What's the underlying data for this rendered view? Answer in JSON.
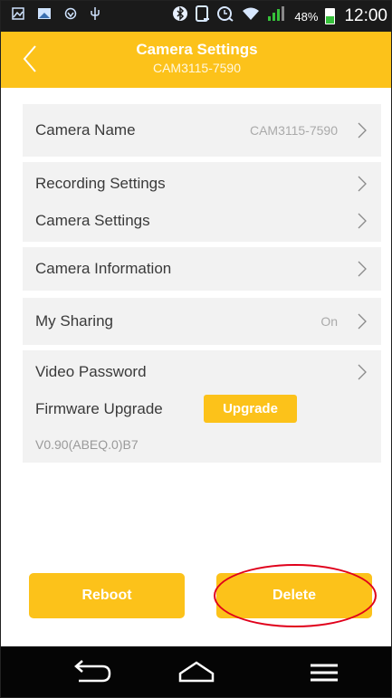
{
  "status_bar": {
    "icons_left": [
      "image-icon",
      "screen-icon",
      "shield-icon",
      "usb-icon"
    ],
    "icons_right": [
      "bluetooth-icon",
      "nfc-icon",
      "alarm-icon",
      "wifi-icon",
      "signal-icon"
    ],
    "battery_percent": "48%",
    "battery_level": 0.48,
    "time": "12:00"
  },
  "header": {
    "title": "Camera Settings",
    "subtitle": "CAM3115-7590",
    "back_icon": "chevron-left-icon"
  },
  "settings": {
    "camera_name": {
      "label": "Camera Name",
      "value": "CAM3115-7590"
    },
    "recording_settings": {
      "label": "Recording Settings"
    },
    "camera_settings": {
      "label": "Camera Settings"
    },
    "camera_information": {
      "label": "Camera Information"
    },
    "my_sharing": {
      "label": "My Sharing",
      "value": "On"
    },
    "video_password": {
      "label": "Video Password"
    },
    "firmware_upgrade": {
      "label": "Firmware Upgrade",
      "button": "Upgrade",
      "version": "V0.90(ABEQ.0)B7"
    }
  },
  "actions": {
    "reboot": "Reboot",
    "delete": "Delete"
  },
  "nav_bar": {
    "icons": [
      "back-icon",
      "home-icon",
      "menu-icon"
    ]
  },
  "colors": {
    "accent": "#fcc21a",
    "card_bg": "#f2f2f2",
    "annotation": "#e0001b",
    "nav_bg": "#050505"
  }
}
